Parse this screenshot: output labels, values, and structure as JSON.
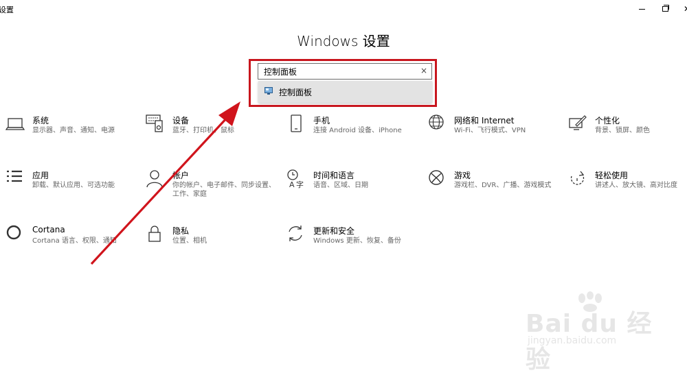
{
  "window": {
    "title": "设置",
    "heading": "Windows 设置"
  },
  "search": {
    "value": "控制面板",
    "clear_icon": "×",
    "suggestion": "控制面板"
  },
  "tiles": [
    {
      "name": "系统",
      "desc": "显示器、声音、通知、电源",
      "icon": "laptop-icon"
    },
    {
      "name": "设备",
      "desc": "蓝牙、打印机、鼠标",
      "icon": "devices-icon"
    },
    {
      "name": "手机",
      "desc": "连接 Android 设备、iPhone",
      "icon": "phone-icon"
    },
    {
      "name": "网络和 Internet",
      "desc": "Wi-Fi、飞行模式、VPN",
      "icon": "globe-icon"
    },
    {
      "name": "个性化",
      "desc": "背景、锁屏、颜色",
      "icon": "personalization-icon"
    },
    {
      "name": "应用",
      "desc": "卸载、默认应用、可选功能",
      "icon": "apps-icon"
    },
    {
      "name": "帐户",
      "desc": "你的帐户、电子邮件、同步设置、工作、家庭",
      "icon": "person-icon"
    },
    {
      "name": "时间和语言",
      "desc": "语音、区域、日期",
      "icon": "time-language-icon"
    },
    {
      "name": "游戏",
      "desc": "游戏栏、DVR、广播、游戏模式",
      "icon": "xbox-icon"
    },
    {
      "name": "轻松使用",
      "desc": "讲述人、放大镜、高对比度",
      "icon": "ease-of-access-icon"
    },
    {
      "name": "Cortana",
      "desc": "Cortana 语言、权限、通知",
      "icon": "cortana-icon"
    },
    {
      "name": "隐私",
      "desc": "位置、相机",
      "icon": "lock-icon"
    },
    {
      "name": "更新和安全",
      "desc": "Windows 更新、恢复、备份",
      "icon": "sync-icon"
    }
  ],
  "watermark": {
    "main": "Bai du 经验",
    "sub": "jingyan.baidu.com"
  },
  "colors": {
    "highlight": "#c8161e",
    "arrow": "#d0141c"
  }
}
